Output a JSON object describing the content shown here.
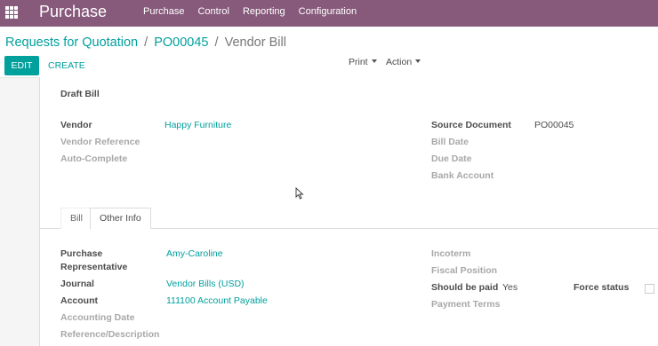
{
  "navbar": {
    "app_name": "Purchase",
    "menu": [
      "Purchase",
      "Control",
      "Reporting",
      "Configuration"
    ]
  },
  "breadcrumb": {
    "level1": "Requests for Quotation",
    "level2": "PO00045",
    "current": "Vendor Bill",
    "separator": "/"
  },
  "buttons": {
    "edit": "EDIT",
    "create": "CREATE",
    "print": "Print",
    "action": "Action"
  },
  "form": {
    "status": "Draft Bill",
    "left": {
      "vendor_label": "Vendor",
      "vendor_value": "Happy Furniture",
      "vendor_reference_label": "Vendor Reference",
      "auto_complete_label": "Auto-Complete"
    },
    "right": {
      "source_document_label": "Source Document",
      "source_document_value": "PO00045",
      "bill_date_label": "Bill Date",
      "due_date_label": "Due Date",
      "bank_account_label": "Bank Account"
    },
    "tabs": [
      "Bill",
      "Other Info"
    ],
    "other_info": {
      "purchase_rep_label_1": "Purchase",
      "purchase_rep_label_2": "Representative",
      "purchase_rep_value": "Amy-Caroline",
      "journal_label": "Journal",
      "journal_value": "Vendor Bills (USD)",
      "account_label": "Account",
      "account_value": "111100 Account Payable",
      "accounting_date_label": "Accounting Date",
      "reference_label": "Reference/Description",
      "incoterm_label": "Incoterm",
      "fiscal_position_label": "Fiscal Position",
      "should_be_paid_label": "Should be paid",
      "should_be_paid_value": "Yes",
      "payment_terms_label": "Payment Terms",
      "force_status_label": "Force status"
    }
  },
  "colors": {
    "navbar": "#875a7b",
    "accent": "#00a09d"
  }
}
